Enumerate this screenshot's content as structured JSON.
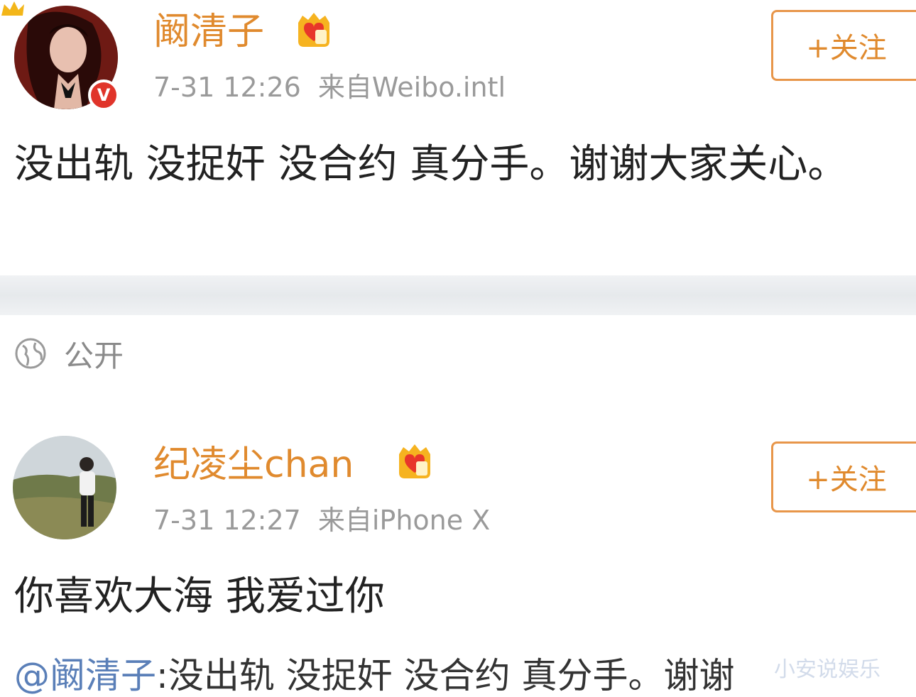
{
  "posts": [
    {
      "username": "阚清子",
      "timestamp": "7-31 12:26",
      "source": "来自Weibo.intl",
      "follow_label": "+关注",
      "content": "没出轨 没捉奸 没合约 真分手。谢谢大家关心。",
      "verified_badge": "V"
    },
    {
      "username": "纪凌尘chan",
      "timestamp": "7-31 12:27",
      "source": "来自iPhone X",
      "follow_label": "+关注",
      "content": "你喜欢大海 我爱过你"
    }
  ],
  "visibility": {
    "label": "公开",
    "icon": "globe-icon"
  },
  "repost": {
    "mention": "@阚清子",
    "text": ":没出轨 没捉奸 没合约 真分手。谢谢"
  },
  "watermark": "小安说娱乐",
  "colors": {
    "username": "#e08a2e",
    "follow_border": "#e8964a",
    "meta": "#9a9a9a",
    "verified": "#e0342a"
  }
}
